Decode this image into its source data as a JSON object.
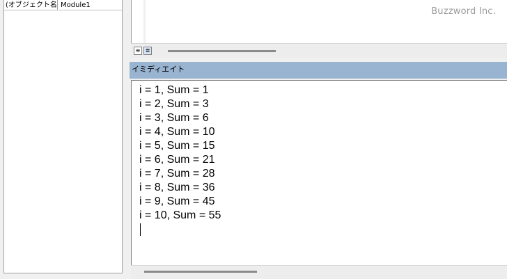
{
  "properties": {
    "name_label": "(オブジェクト名)",
    "value": "Module1"
  },
  "code_window": {
    "watermark": "Buzzword Inc."
  },
  "immediate_window": {
    "title": "イミディエイト",
    "lines": [
      "i = 1, Sum = 1",
      "i = 2, Sum = 3",
      "i = 3, Sum = 6",
      "i = 4, Sum = 10",
      "i = 5, Sum = 15",
      "i = 6, Sum = 21",
      "i = 7, Sum = 28",
      "i = 8, Sum = 36",
      "i = 9, Sum = 45",
      "i = 10, Sum = 55"
    ]
  },
  "colors": {
    "titlebar": "#99b4d1",
    "background": "#f0f0f0",
    "editor": "#ffffff"
  },
  "icons": [
    "procedure-view-icon",
    "full-module-view-icon"
  ]
}
